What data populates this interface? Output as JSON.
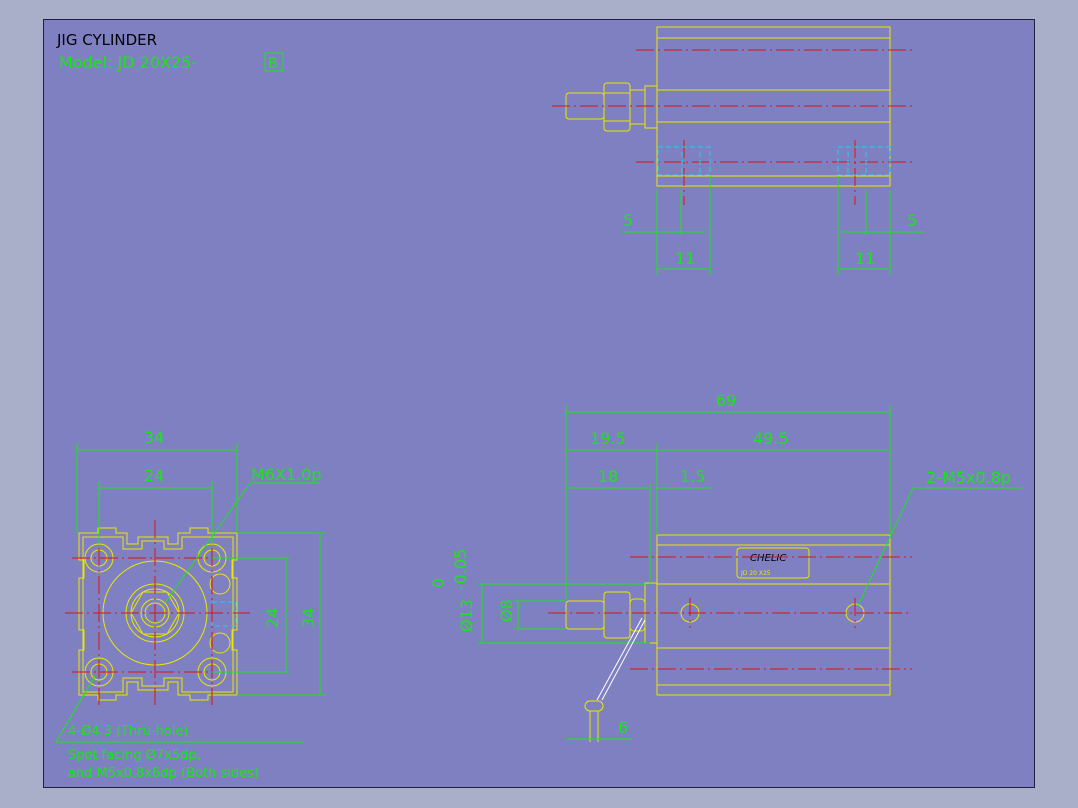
{
  "title": "JIG CYLINDER",
  "model_prefix": "Model:  JD 20X25-",
  "model_suffix": "B",
  "top_view": {
    "dim_5_left": "5",
    "dim_11_left": "11",
    "dim_5_right": "5",
    "dim_11_right": "11"
  },
  "side_view": {
    "overall_length": "69",
    "length_19_5": "19.5",
    "length_49_5": "49.5",
    "length_18": "18",
    "length_1_5": "1.5",
    "port_label": "2-M5x0.8p",
    "rod_diameter": "Ø8",
    "tolerance_upper": "0",
    "tolerance_lower": "-0.05",
    "boss_diameter": "Ø13",
    "width_6": "6",
    "brand_label": "CHELIC",
    "brand_sub": "JD 20 X25"
  },
  "end_view": {
    "width_34": "34",
    "pitch_24": "24",
    "thread_label": "M6X1.0p",
    "height_24": "24",
    "height_34": "34",
    "hole_label": "4-Ø4.3 (Thru-hole)",
    "note_line1": "Spot facing Ø7x5dp,",
    "note_line2": "and M5x0.8x6dp (Both sides)"
  },
  "colors": {
    "background": "#7f80c1",
    "outline": "#e8e800",
    "dimension": "#19e619",
    "centerline": "#e01010",
    "hidden": "#20d0f0"
  }
}
